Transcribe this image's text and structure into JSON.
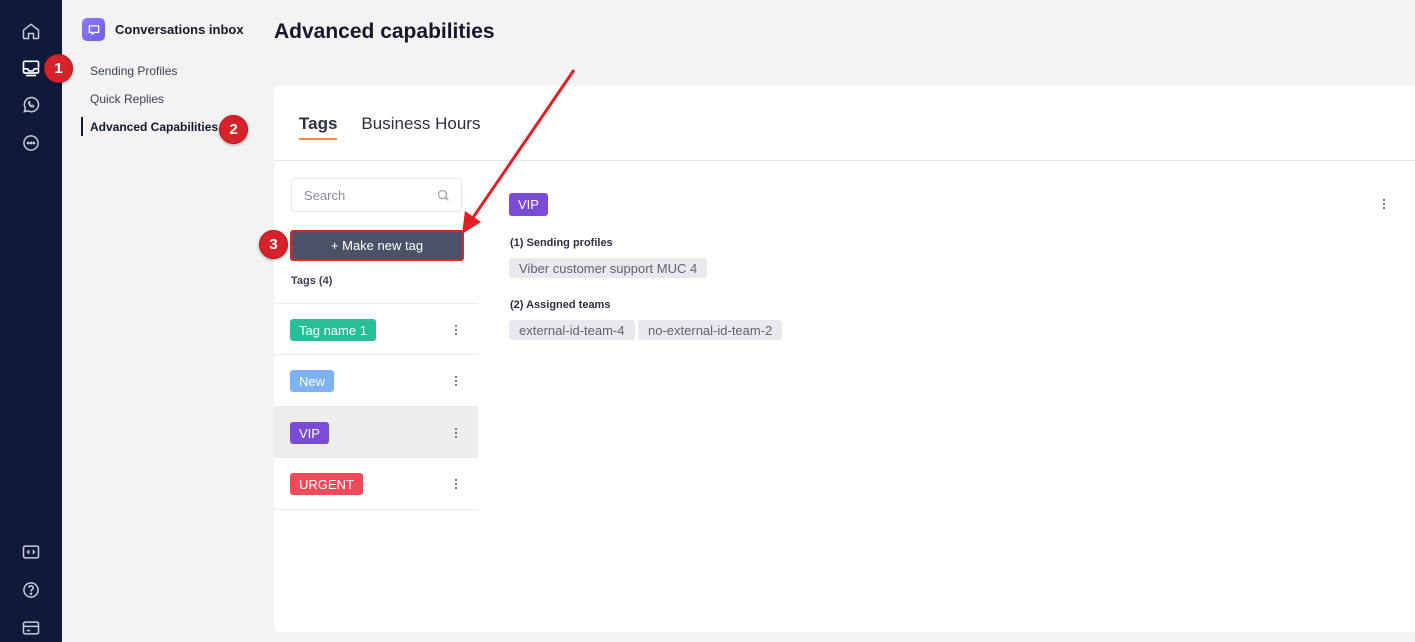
{
  "rail": {
    "icons": [
      "home-icon",
      "inbox-icon",
      "whatsapp-icon",
      "chat-bubble-icon",
      "code-icon",
      "help-icon",
      "billing-card-icon"
    ]
  },
  "subnav": {
    "title": "Conversations inbox",
    "items": [
      {
        "label": "Sending Profiles"
      },
      {
        "label": "Quick Replies"
      },
      {
        "label": "Advanced Capabilities"
      }
    ]
  },
  "page": {
    "title": "Advanced capabilities"
  },
  "tabs": [
    {
      "label": "Tags"
    },
    {
      "label": "Business Hours"
    }
  ],
  "search": {
    "placeholder": "Search"
  },
  "make_tag_button": "+ Make new tag",
  "tags_count": "Tags (4)",
  "tags": [
    {
      "label": "Tag name 1",
      "color": "#26bf97"
    },
    {
      "label": "New",
      "color": "#7fb1f5"
    },
    {
      "label": "VIP",
      "color": "#7a4bd6"
    },
    {
      "label": "URGENT",
      "color": "#f04a5b"
    }
  ],
  "detail": {
    "tag": "VIP",
    "sending_profiles_label": "(1) Sending profiles",
    "sending_profiles": [
      "Viber customer support MUC 4"
    ],
    "assigned_teams_label": "(2) Assigned teams",
    "assigned_teams": [
      "external-id-team-4",
      "no-external-id-team-2"
    ]
  },
  "annotations": {
    "badges": [
      "1",
      "2",
      "3"
    ],
    "color": "#d8222a"
  }
}
